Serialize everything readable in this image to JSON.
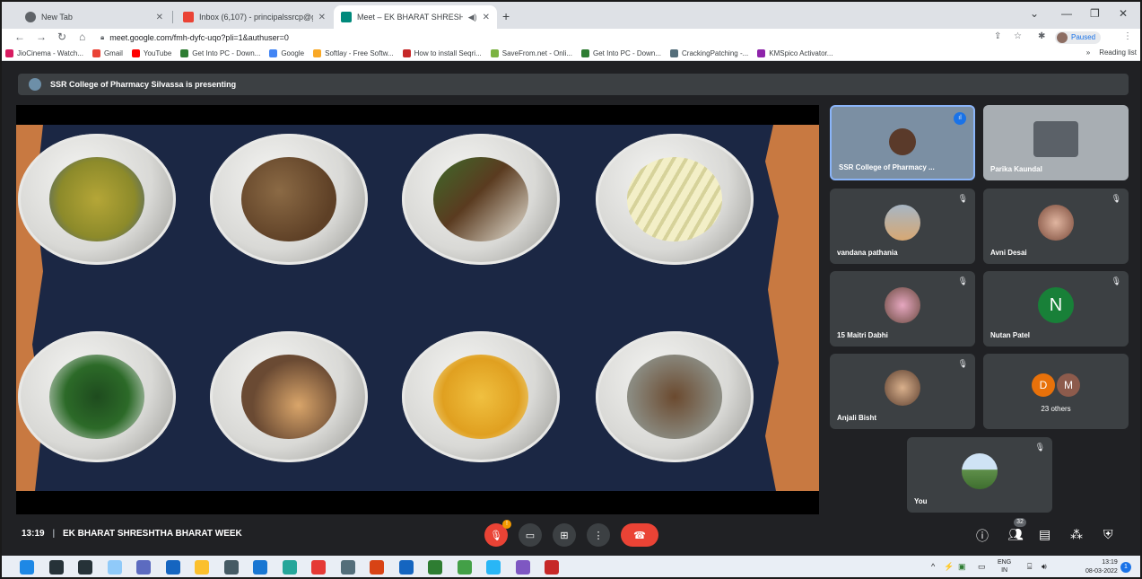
{
  "browser": {
    "tabs": [
      {
        "title": "New Tab",
        "favicon": "chrome-icon"
      },
      {
        "title": "Inbox (6,107) - principalssrcp@g",
        "favicon": "gmail-icon"
      },
      {
        "title": "Meet – EK BHARAT SHRESHT",
        "favicon": "meet-icon",
        "active": true
      }
    ],
    "new_tab": "+",
    "url": "meet.google.com/fmh-dyfc-uqo?pli=1&authuser=0",
    "profile_status": "Paused",
    "bookmarks": [
      {
        "label": "JioCinema - Watch...",
        "color": "#d81b60"
      },
      {
        "label": "Gmail",
        "color": "#ea4335"
      },
      {
        "label": "YouTube",
        "color": "#ff0000"
      },
      {
        "label": "Get Into PC - Down...",
        "color": "#2e7d32"
      },
      {
        "label": "Google",
        "color": "#4285f4"
      },
      {
        "label": "Softlay - Free Softw...",
        "color": "#f9a825"
      },
      {
        "label": "How to install Seqri...",
        "color": "#c62828"
      },
      {
        "label": "SaveFrom.net - Onli...",
        "color": "#7cb342"
      },
      {
        "label": "Get Into PC - Down...",
        "color": "#2e7d32"
      },
      {
        "label": "CrackingPatching -...",
        "color": "#546e7a"
      },
      {
        "label": "KMSpico Activator...",
        "color": "#8e24aa"
      }
    ],
    "reading_list": "Reading list",
    "more": "»"
  },
  "meet": {
    "presenting_banner": "SSR College of Pharmacy Silvassa is presenting",
    "meeting_time": "13:19",
    "meeting_separator": "|",
    "meeting_title": "EK BHARAT SHRESHTHA BHARAT WEEK",
    "participants": [
      {
        "name": "SSR College of Pharmacy ...",
        "type": "video"
      },
      {
        "name": "Parika Kaundal",
        "type": "video"
      },
      {
        "name": "vandana pathania",
        "type": "photo",
        "muted": true
      },
      {
        "name": "Avni Desai",
        "type": "photo",
        "muted": true
      },
      {
        "name": "15 Maitri Dabhi",
        "type": "photo",
        "muted": true
      },
      {
        "name": "Nutan Patel",
        "type": "letter",
        "letter": "N",
        "color": "#188038",
        "muted": true
      },
      {
        "name": "Anjali Bisht",
        "type": "photo",
        "muted": true
      },
      {
        "name": "23 others",
        "type": "group",
        "letters": [
          "D",
          "M"
        ],
        "colors": [
          "#e8710a",
          "#8d5b4c"
        ]
      },
      {
        "name": "You",
        "type": "photo",
        "muted": true
      }
    ],
    "people_count": "32",
    "mic_alert": "!"
  },
  "taskbar": {
    "language_top": "ENG",
    "language_bottom": "IN",
    "time": "13:19",
    "date": "08-03-2022",
    "notifications": "1"
  },
  "colors": {
    "slide_bg": "#1b2744",
    "slide_accent": "#c87941",
    "end_call": "#ea4335"
  }
}
